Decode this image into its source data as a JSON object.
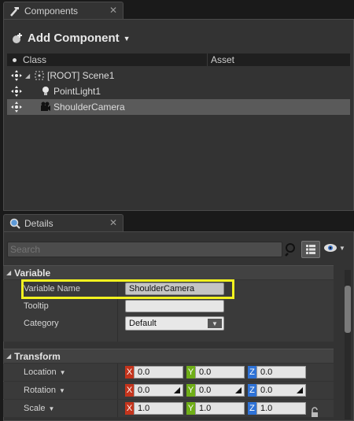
{
  "components": {
    "tab_label": "Components",
    "tab_close": "✕",
    "add_component_label": "Add Component",
    "columns": {
      "class": "Class",
      "asset": "Asset"
    },
    "tree": [
      {
        "label": "[ROOT] Scene1"
      },
      {
        "label": "PointLight1"
      },
      {
        "label": "ShoulderCamera"
      }
    ]
  },
  "details": {
    "tab_label": "Details",
    "tab_close": "✕",
    "search_placeholder": "Search",
    "variable": {
      "header": "Variable",
      "variable_name_label": "Variable Name",
      "variable_name_value": "ShoulderCamera",
      "tooltip_label": "Tooltip",
      "tooltip_value": "",
      "category_label": "Category",
      "category_value": "Default"
    },
    "transform": {
      "header": "Transform",
      "location_label": "Location",
      "rotation_label": "Rotation",
      "scale_label": "Scale",
      "axis_labels": {
        "x": "X",
        "y": "Y",
        "z": "Z"
      },
      "location": [
        "0.0",
        "0.0",
        "0.0"
      ],
      "rotation": [
        "0.0",
        "0.0",
        "0.0"
      ],
      "scale": [
        "1.0",
        "1.0",
        "1.0"
      ]
    }
  },
  "colors": {
    "highlight": "#f2f21f",
    "axis_x": "#c4341c",
    "axis_y": "#6fae17",
    "axis_z": "#2e72d6",
    "selection": "#5a5a5a"
  }
}
